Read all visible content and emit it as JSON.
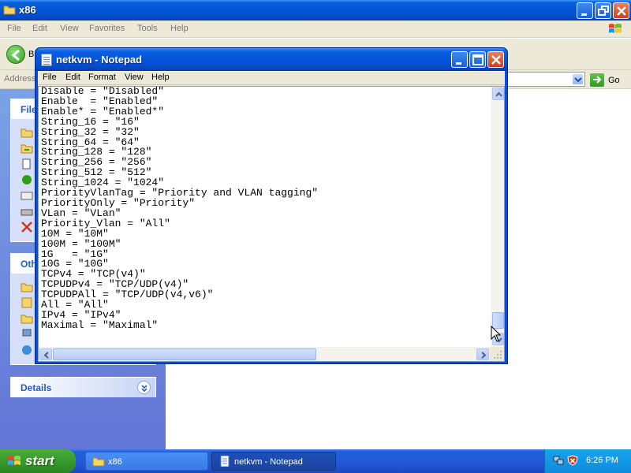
{
  "explorer": {
    "title": "x86",
    "menu": [
      "File",
      "Edit",
      "View",
      "Favorites",
      "Tools",
      "Help"
    ],
    "back_label": "B",
    "address_label": "Address",
    "go_label": "Go",
    "sidebar": {
      "file_tasks_heading": "File",
      "other_places_heading": "Oth",
      "details_heading": "Details"
    }
  },
  "notepad": {
    "title": "netkvm - Notepad",
    "menu": [
      "File",
      "Edit",
      "Format",
      "View",
      "Help"
    ],
    "lines": [
      "Disable = \"Disabled\"",
      "Enable  = \"Enabled\"",
      "Enable* = \"Enabled*\"",
      "String_16 = \"16\"",
      "String_32 = \"32\"",
      "String_64 = \"64\"",
      "String_128 = \"128\"",
      "String_256 = \"256\"",
      "String_512 = \"512\"",
      "String_1024 = \"1024\"",
      "PriorityVlanTag = \"Priority and VLAN tagging\"",
      "PriorityOnly = \"Priority\"",
      "VLan = \"VLan\"",
      "Priority_Vlan = \"All\"",
      "10M = \"10M\"",
      "100M = \"100M\"",
      "1G   = \"1G\"",
      "10G = \"10G\"",
      "TCPv4 = \"TCP(v4)\"",
      "TCPUDPv4 = \"TCP/UDP(v4)\"",
      "TCPUDPAll = \"TCP/UDP(v4,v6)\"",
      "All = \"All\"",
      "IPv4 = \"IPv4\"",
      "Maximal = \"Maximal\""
    ]
  },
  "taskbar": {
    "start_label": "start",
    "items": [
      {
        "label": "x86",
        "icon": "folder-icon"
      },
      {
        "label": "netkvm - Notepad",
        "icon": "notepad-icon"
      }
    ],
    "clock": "6:26 PM"
  },
  "colors": {
    "xp_blue": "#0454d9",
    "start_green": "#379b2b",
    "sidebar_blue": "#7ba2e7",
    "tray_blue": "#17a3ee"
  }
}
